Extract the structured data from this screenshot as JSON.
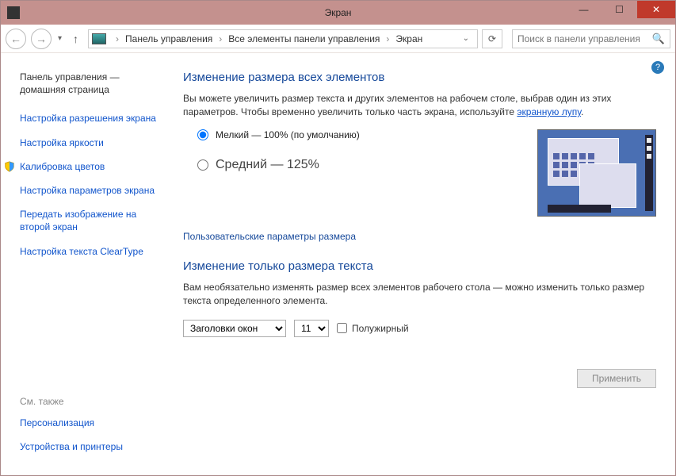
{
  "titlebar": {
    "title": "Экран"
  },
  "nav": {
    "breadcrumb": [
      "Панель управления",
      "Все элементы панели управления",
      "Экран"
    ],
    "search_placeholder": "Поиск в панели управления"
  },
  "sidebar": {
    "home": "Панель управления — домашняя страница",
    "links": [
      "Настройка разрешения экрана",
      "Настройка яркости",
      "Калибровка цветов",
      "Настройка параметров экрана",
      "Передать изображение на второй экран",
      "Настройка текста ClearType"
    ],
    "see_also_label": "См. также",
    "see_also": [
      "Персонализация",
      "Устройства и принтеры"
    ]
  },
  "main": {
    "heading1": "Изменение размера всех элементов",
    "intro_pre": "Вы можете увеличить размер текста и других элементов на рабочем столе, выбрав один из этих параметров. Чтобы временно увеличить только часть экрана, используйте ",
    "intro_link": "экранную лупу",
    "intro_post": ".",
    "radio_small": "Мелкий — 100% (по умолчанию)",
    "radio_medium": "Средний — 125%",
    "custom_link": "Пользовательские параметры размера",
    "heading2": "Изменение только размера текста",
    "text2": "Вам необязательно изменять размер всех элементов рабочего стола — можно изменить только размер текста определенного элемента.",
    "select_element": "Заголовки окон",
    "select_size": "11",
    "bold_label": "Полужирный",
    "apply": "Применить"
  }
}
